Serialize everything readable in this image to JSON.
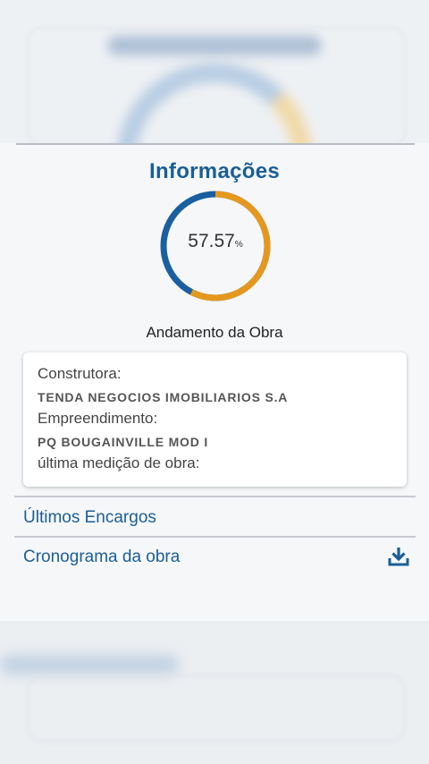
{
  "modal": {
    "title": "Informações",
    "progress": {
      "value_text": "57.57",
      "unit": "%",
      "fraction": 0.5757,
      "label": "Andamento da Obra",
      "colors": {
        "progress": "#e6981e",
        "remaining": "#1a5fa0"
      }
    },
    "info_card": {
      "builder_label": "Construtora:",
      "builder_value": "TENDA NEGOCIOS IMOBILIARIOS S.A",
      "development_label": "Empreendimento:",
      "development_value": "PQ BOUGAINVILLE MOD I",
      "last_measurement_label": "última medição de obra:"
    },
    "links": {
      "charges": "Últimos Encargos",
      "schedule": "Cronograma da obra"
    },
    "icons": {
      "download": "download-icon"
    },
    "accent_color": "#1b5e96"
  }
}
